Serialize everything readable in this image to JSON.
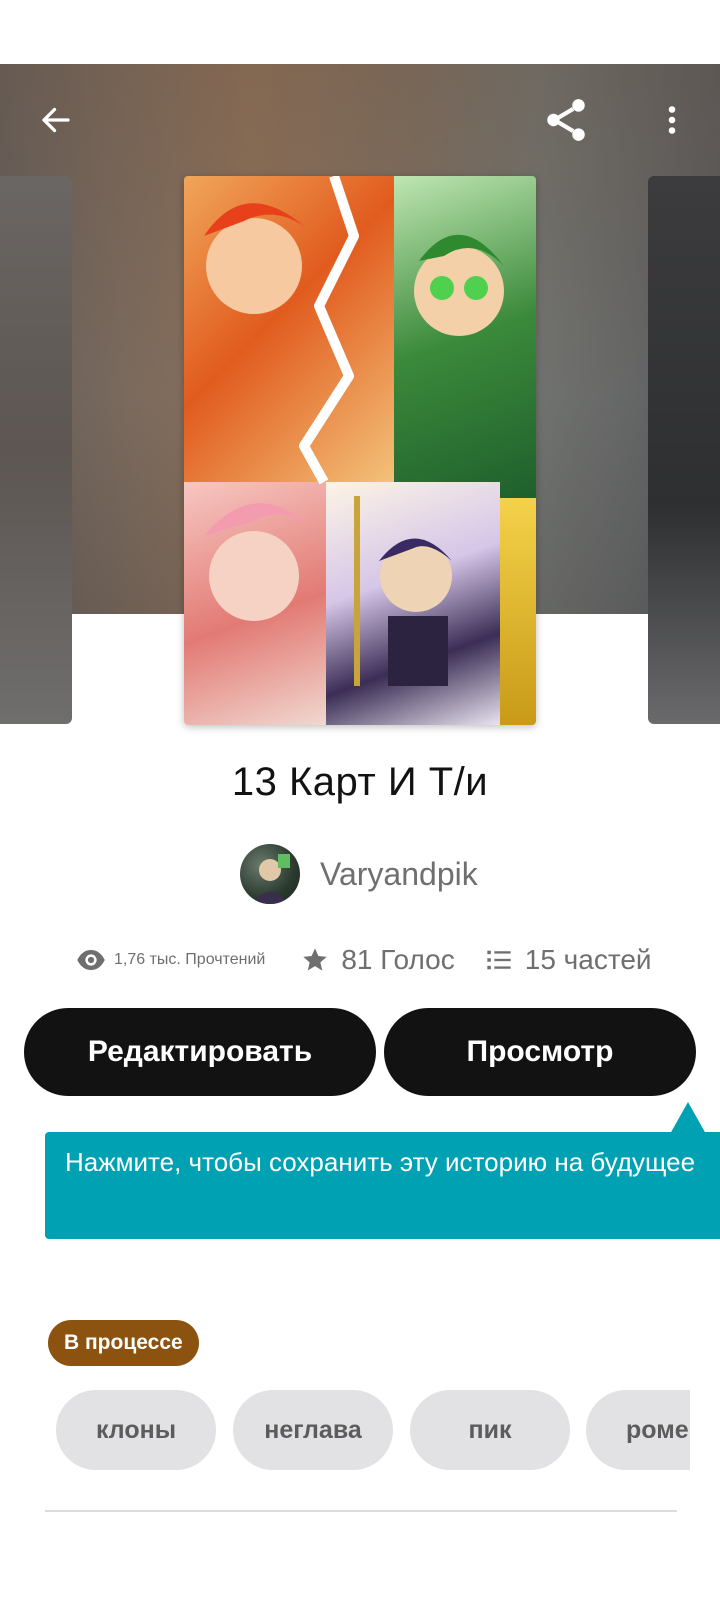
{
  "story": {
    "title": "13 Карт И Т/и",
    "author": "Varyandpik"
  },
  "stats": {
    "reads": "1,76 тыс. Прочтений",
    "votes": "81 Голос",
    "parts": "15 частей"
  },
  "actions": {
    "edit_label": "Редактировать",
    "view_label": "Просмотр"
  },
  "tooltip": {
    "text": "Нажмите, чтобы сохранить эту историю на будущее"
  },
  "status_badge": "В процессе",
  "tags": [
    "клоны",
    "неглава",
    "пик",
    "роме"
  ],
  "icons": {
    "back": "arrow-left-icon",
    "share": "share-icon",
    "more": "more-vertical-icon",
    "reads": "eye-icon",
    "votes": "star-icon",
    "parts": "list-icon"
  },
  "colors": {
    "primary_button": "#121212",
    "tooltip": "#00a1b3",
    "status_badge": "#8c520f",
    "tag_bg": "#e2e1e4"
  }
}
